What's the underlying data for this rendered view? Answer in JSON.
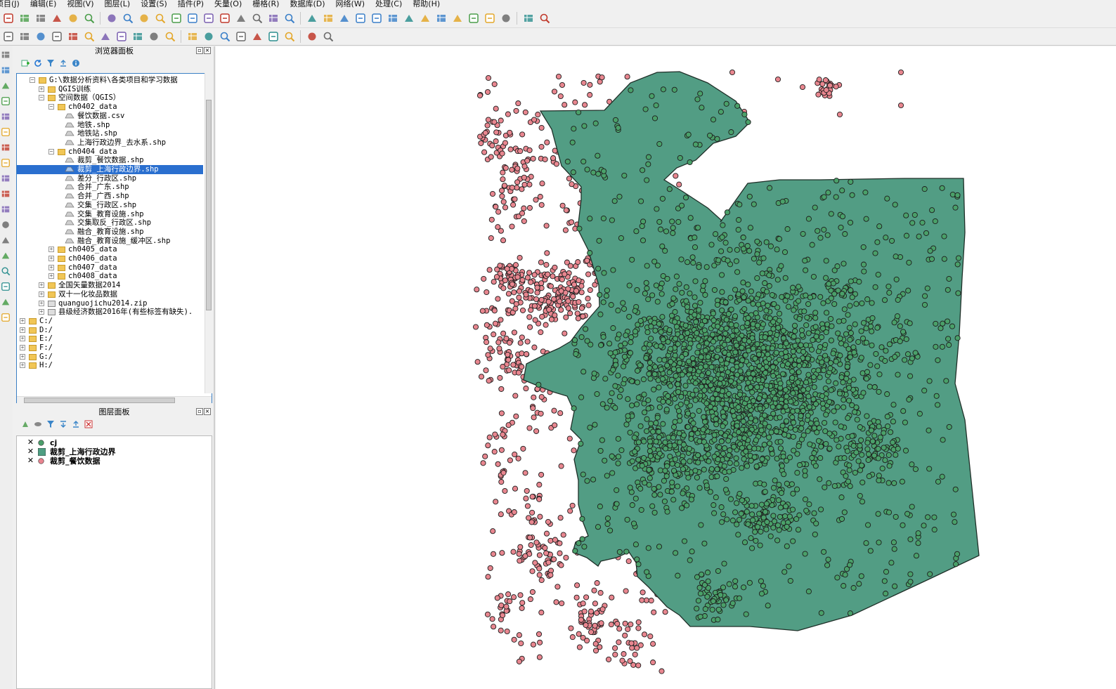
{
  "menubar": {
    "items": [
      "项目(J)",
      "编辑(E)",
      "视图(V)",
      "图层(L)",
      "设置(S)",
      "插件(P)",
      "矢量(O)",
      "栅格(R)",
      "数据库(D)",
      "网络(W)",
      "处理(C)",
      "帮助(H)"
    ]
  },
  "browser_panel": {
    "title": "浏览器面板",
    "items": [
      {
        "label": "G:\\数据分析资料\\各类项目和学习数据",
        "level": 1,
        "type": "folder",
        "expanded": true
      },
      {
        "label": "QGIS训练",
        "level": 2,
        "type": "folder",
        "expanded": false
      },
      {
        "label": "空间数据（QGIS）",
        "level": 2,
        "type": "folder",
        "expanded": true
      },
      {
        "label": "ch0402_data",
        "level": 3,
        "type": "folder",
        "expanded": true
      },
      {
        "label": "餐饮数据.csv",
        "level": 4,
        "type": "file"
      },
      {
        "label": "地铁.shp",
        "level": 4,
        "type": "file"
      },
      {
        "label": "地铁站.shp",
        "level": 4,
        "type": "file"
      },
      {
        "label": "上海行政边界_去水系.shp",
        "level": 4,
        "type": "file"
      },
      {
        "label": "ch0404_data",
        "level": 3,
        "type": "folder",
        "expanded": true
      },
      {
        "label": "裁剪_餐饮数据.shp",
        "level": 4,
        "type": "file"
      },
      {
        "label": "裁剪_上海行政边界.shp",
        "level": 4,
        "type": "file",
        "selected": true
      },
      {
        "label": "差分_行政区.shp",
        "level": 4,
        "type": "file"
      },
      {
        "label": "合并_广东.shp",
        "level": 4,
        "type": "file"
      },
      {
        "label": "合并_广西.shp",
        "level": 4,
        "type": "file"
      },
      {
        "label": "交集_行政区.shp",
        "level": 4,
        "type": "file"
      },
      {
        "label": "交集_教育设施.shp",
        "level": 4,
        "type": "file"
      },
      {
        "label": "交集取反_行政区.shp",
        "level": 4,
        "type": "file"
      },
      {
        "label": "融合_教育设施.shp",
        "level": 4,
        "type": "file"
      },
      {
        "label": "融合_教育设施_缓冲区.shp",
        "level": 4,
        "type": "file"
      },
      {
        "label": "ch0405_data",
        "level": 3,
        "type": "folder",
        "expanded": false
      },
      {
        "label": "ch0406_data",
        "level": 3,
        "type": "folder",
        "expanded": false
      },
      {
        "label": "ch0407_data",
        "level": 3,
        "type": "folder",
        "expanded": false
      },
      {
        "label": "ch0408_data",
        "level": 3,
        "type": "folder",
        "expanded": false
      },
      {
        "label": "全国矢量数据2014",
        "level": 2,
        "type": "folder",
        "expanded": false
      },
      {
        "label": "双十一化妆品数据",
        "level": 2,
        "type": "folder",
        "expanded": false
      },
      {
        "label": "quanguojichu2014.zip",
        "level": 2,
        "type": "zip",
        "expanded": false
      },
      {
        "label": "县级经济数据2016年(有些标签有缺失).",
        "level": 2,
        "type": "zip",
        "expanded": false
      },
      {
        "label": "C:/",
        "level": 0,
        "type": "drive",
        "expanded": false
      },
      {
        "label": "D:/",
        "level": 0,
        "type": "drive",
        "expanded": false
      },
      {
        "label": "E:/",
        "level": 0,
        "type": "drive",
        "expanded": false
      },
      {
        "label": "F:/",
        "level": 0,
        "type": "drive",
        "expanded": false
      },
      {
        "label": "G:/",
        "level": 0,
        "type": "drive",
        "expanded": false
      },
      {
        "label": "H:/",
        "level": 0,
        "type": "drive",
        "expanded": false
      }
    ]
  },
  "layers_panel": {
    "title": "图层面板",
    "layers": [
      {
        "name": "cj",
        "symbol": "point",
        "color": "#4a9e6a",
        "visible": true
      },
      {
        "name": "裁剪_上海行政边界",
        "symbol": "polygon",
        "color": "#4e9e82",
        "visible": true
      },
      {
        "name": "裁剪_餐饮数据",
        "symbol": "point",
        "color": "#e8848f",
        "visible": true
      }
    ]
  },
  "map": {
    "polygon_fill": "#529d84",
    "inside_point_fill": "#4aa069",
    "outside_point_fill": "#e8868f",
    "point_stroke": "#1d1d1d"
  },
  "icons": {
    "toolbar1": [
      "new-project-icon",
      "open-icon",
      "save-icon",
      "save-as-icon",
      "print-layout-icon",
      "layout-manager-icon",
      "sep",
      "pan-select-icon",
      "pan-icon",
      "pan-to-selection-icon",
      "zoom-in-icon",
      "zoom-out-icon",
      "zoom-native-icon",
      "zoom-full-icon",
      "zoom-layer-icon",
      "zoom-selection-icon",
      "zoom-last-icon",
      "zoom-next-icon",
      "refresh-icon",
      "sep",
      "identify-icon",
      "action-icon",
      "select-icon",
      "deselect-icon",
      "expression-select-icon",
      "attribute-table-icon",
      "field-calc-icon",
      "statistics-icon",
      "measure-icon",
      "map-tips-icon",
      "bookmark-icon",
      "annotation-icon",
      "text-annotation-icon",
      "sep",
      "help-icon",
      "whats-this-icon"
    ],
    "toolbar2": [
      "digitize-icon",
      "edit-pencil-icon",
      "save-edits-icon",
      "add-feature-icon",
      "add-polygon-icon",
      "vertex-tool-icon",
      "node-tool-icon",
      "delete-icon",
      "cut-icon",
      "copy-icon",
      "paste-icon",
      "sep",
      "label-icon",
      "label-pin-icon",
      "label-move-icon",
      "label-rotate-icon",
      "label-change-icon",
      "label-show-icon",
      "label-properties-icon",
      "sep",
      "csv-icon",
      "python-icon"
    ],
    "vertical": [
      "add-vector-icon",
      "add-raster-icon",
      "add-postgis-icon",
      "add-spatialite-icon",
      "add-mssql-icon",
      "add-oracle-icon",
      "add-wms-icon",
      "add-wcs-icon",
      "add-wfs-icon",
      "add-delimited-icon",
      "add-virtual-icon",
      "new-layer-icon",
      "add-gpx-icon",
      "digitize-line-icon",
      "add-part-icon",
      "measure-line-icon",
      "gps-icon",
      "osm-icon"
    ]
  }
}
